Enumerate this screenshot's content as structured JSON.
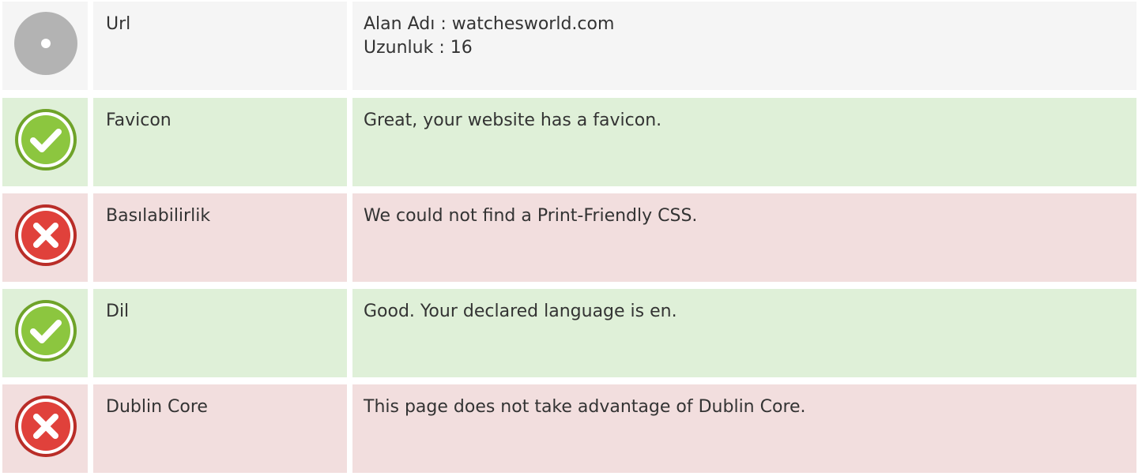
{
  "colors": {
    "neutral_row": "#f5f5f5",
    "pass_row": "#dff0d8",
    "fail_row": "#f2dede",
    "pass_icon": "#8cc63f",
    "fail_icon": "#e0413b",
    "neutral_icon": "#b3b3b3"
  },
  "rows": [
    {
      "status": "neutral",
      "icon": "circle-dot-icon",
      "label": "Url",
      "value_lines": [
        "Alan Adı : watchesworld.com",
        "Uzunluk : 16"
      ]
    },
    {
      "status": "pass",
      "icon": "check-circle-icon",
      "label": "Favicon",
      "value_lines": [
        "Great, your website has a favicon."
      ]
    },
    {
      "status": "fail",
      "icon": "x-circle-icon",
      "label": "Basılabilirlik",
      "value_lines": [
        "We could not find a Print-Friendly CSS."
      ]
    },
    {
      "status": "pass",
      "icon": "check-circle-icon",
      "label": "Dil",
      "value_lines": [
        "Good. Your declared language is en."
      ]
    },
    {
      "status": "fail",
      "icon": "x-circle-icon",
      "label": "Dublin Core",
      "value_lines": [
        "This page does not take advantage of Dublin Core."
      ]
    }
  ]
}
